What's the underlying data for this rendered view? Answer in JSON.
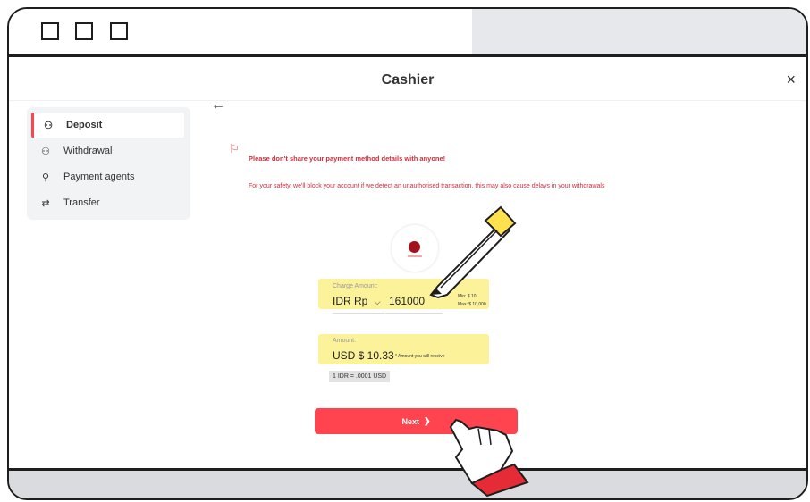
{
  "app": {
    "title": "Cashier",
    "close_icon": "×",
    "back_icon": "←"
  },
  "sidebar": {
    "items": [
      {
        "label": "Deposit",
        "icon": "deposit-icon",
        "active": true
      },
      {
        "label": "Withdrawal",
        "icon": "withdrawal-icon",
        "active": false
      },
      {
        "label": "Payment agents",
        "icon": "payment-agents-icon",
        "active": false
      },
      {
        "label": "Transfer",
        "icon": "transfer-icon",
        "active": false
      }
    ]
  },
  "warning": {
    "title": "Please don't share your payment method details with anyone!",
    "text": "For your safety, we'll block your account if we detect an unauthorised transaction, this may also cause delays in your withdrawals"
  },
  "charge": {
    "label": "Charge Amount:",
    "currency": "IDR Rp",
    "value": "161000",
    "min": "Min:       $ 10",
    "max": "Max: $ 10,000"
  },
  "amount": {
    "label": "Amount:",
    "value": "USD $ 10.33",
    "note": "* Amount you will receive"
  },
  "rate": "1 IDR = .0001 USD",
  "next_button": "Next",
  "colors": {
    "accent": "#ff444f",
    "warning": "#cc2e3d",
    "highlight": "#fbf29a"
  }
}
